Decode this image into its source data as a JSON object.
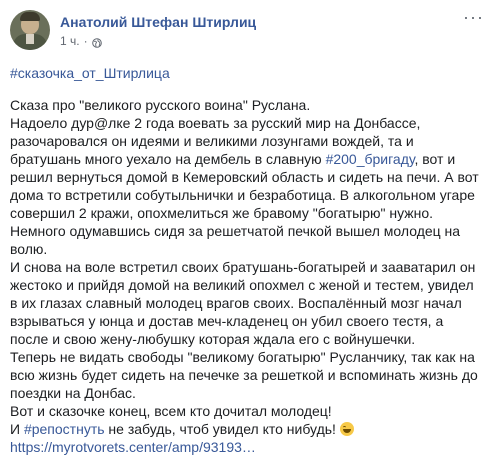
{
  "post": {
    "author": "Анатолий Штефан Штирлиц",
    "time": "1 ч.",
    "dot": "·",
    "more": "···",
    "hashtag_top": "#сказочка_от_Штирлица",
    "lines": {
      "l1": "Сказа про \"великого русского воина\" Руслана.",
      "l2a": "Надоело дур@лке 2 года воевать за русский мир на Донбассе, разочаровался он идеями и великими лозунгами вождей, та и братушань много уехало на дембель в славную ",
      "l2tag": "#200_бригаду",
      "l2b": ", вот и решил вернуться домой в Кемеровский область и сидеть на печи. А вот дома то встретили собутыльнички и безработица. В алкогольном угаре совершил 2 кражи, опохмелиться же бравому \"богатырю\" нужно.",
      "l3": "Немного одумавшись сидя за решетчатой печкой вышел молодец на волю.",
      "l4": "И снова на воле встретил своих братушань-богатырей и зааватарил он жестоко и прийдя домой на великий опохмел с женой и тестем, увидел в их глазах славный молодец врагов своих. Воспалённый мозг начал взрываться у юнца и достав меч-кладенец он убил своего тестя, а после и свою жену-любушку которая ждала его с войнушечки.",
      "l5": "Теперь не видать свободы \"великому богатырю\" Русланчику, так как на всю жизнь будет сидеть на печечке за решеткой и вспоминать жизнь до поездки на Донбас.",
      "l6": "Вот и сказочке конец, всем кто дочитал молодец!",
      "l7a": "И ",
      "l7tag": "#репостнуть",
      "l7b": " не забудь, чтоб увидел кто нибудь! ",
      "url": "https://myrotvorets.center/amp/93193…"
    },
    "icons": {
      "globe": "globe-icon",
      "emoji": "laughing-emoji-icon"
    }
  }
}
